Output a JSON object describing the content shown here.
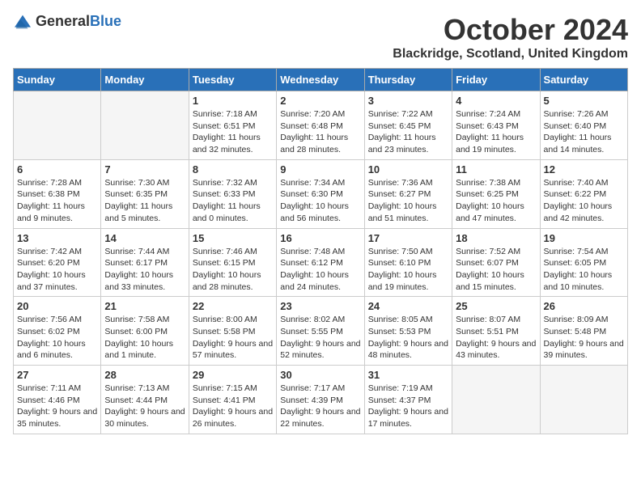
{
  "logo": {
    "general": "General",
    "blue": "Blue"
  },
  "title": "October 2024",
  "location": "Blackridge, Scotland, United Kingdom",
  "days_of_week": [
    "Sunday",
    "Monday",
    "Tuesday",
    "Wednesday",
    "Thursday",
    "Friday",
    "Saturday"
  ],
  "weeks": [
    {
      "row_style": "row-white",
      "days": [
        {
          "num": "",
          "empty": true
        },
        {
          "num": "",
          "empty": true
        },
        {
          "num": "1",
          "sunrise": "Sunrise: 7:18 AM",
          "sunset": "Sunset: 6:51 PM",
          "daylight": "Daylight: 11 hours and 32 minutes."
        },
        {
          "num": "2",
          "sunrise": "Sunrise: 7:20 AM",
          "sunset": "Sunset: 6:48 PM",
          "daylight": "Daylight: 11 hours and 28 minutes."
        },
        {
          "num": "3",
          "sunrise": "Sunrise: 7:22 AM",
          "sunset": "Sunset: 6:45 PM",
          "daylight": "Daylight: 11 hours and 23 minutes."
        },
        {
          "num": "4",
          "sunrise": "Sunrise: 7:24 AM",
          "sunset": "Sunset: 6:43 PM",
          "daylight": "Daylight: 11 hours and 19 minutes."
        },
        {
          "num": "5",
          "sunrise": "Sunrise: 7:26 AM",
          "sunset": "Sunset: 6:40 PM",
          "daylight": "Daylight: 11 hours and 14 minutes."
        }
      ]
    },
    {
      "row_style": "row-gray",
      "days": [
        {
          "num": "6",
          "sunrise": "Sunrise: 7:28 AM",
          "sunset": "Sunset: 6:38 PM",
          "daylight": "Daylight: 11 hours and 9 minutes."
        },
        {
          "num": "7",
          "sunrise": "Sunrise: 7:30 AM",
          "sunset": "Sunset: 6:35 PM",
          "daylight": "Daylight: 11 hours and 5 minutes."
        },
        {
          "num": "8",
          "sunrise": "Sunrise: 7:32 AM",
          "sunset": "Sunset: 6:33 PM",
          "daylight": "Daylight: 11 hours and 0 minutes."
        },
        {
          "num": "9",
          "sunrise": "Sunrise: 7:34 AM",
          "sunset": "Sunset: 6:30 PM",
          "daylight": "Daylight: 10 hours and 56 minutes."
        },
        {
          "num": "10",
          "sunrise": "Sunrise: 7:36 AM",
          "sunset": "Sunset: 6:27 PM",
          "daylight": "Daylight: 10 hours and 51 minutes."
        },
        {
          "num": "11",
          "sunrise": "Sunrise: 7:38 AM",
          "sunset": "Sunset: 6:25 PM",
          "daylight": "Daylight: 10 hours and 47 minutes."
        },
        {
          "num": "12",
          "sunrise": "Sunrise: 7:40 AM",
          "sunset": "Sunset: 6:22 PM",
          "daylight": "Daylight: 10 hours and 42 minutes."
        }
      ]
    },
    {
      "row_style": "row-white",
      "days": [
        {
          "num": "13",
          "sunrise": "Sunrise: 7:42 AM",
          "sunset": "Sunset: 6:20 PM",
          "daylight": "Daylight: 10 hours and 37 minutes."
        },
        {
          "num": "14",
          "sunrise": "Sunrise: 7:44 AM",
          "sunset": "Sunset: 6:17 PM",
          "daylight": "Daylight: 10 hours and 33 minutes."
        },
        {
          "num": "15",
          "sunrise": "Sunrise: 7:46 AM",
          "sunset": "Sunset: 6:15 PM",
          "daylight": "Daylight: 10 hours and 28 minutes."
        },
        {
          "num": "16",
          "sunrise": "Sunrise: 7:48 AM",
          "sunset": "Sunset: 6:12 PM",
          "daylight": "Daylight: 10 hours and 24 minutes."
        },
        {
          "num": "17",
          "sunrise": "Sunrise: 7:50 AM",
          "sunset": "Sunset: 6:10 PM",
          "daylight": "Daylight: 10 hours and 19 minutes."
        },
        {
          "num": "18",
          "sunrise": "Sunrise: 7:52 AM",
          "sunset": "Sunset: 6:07 PM",
          "daylight": "Daylight: 10 hours and 15 minutes."
        },
        {
          "num": "19",
          "sunrise": "Sunrise: 7:54 AM",
          "sunset": "Sunset: 6:05 PM",
          "daylight": "Daylight: 10 hours and 10 minutes."
        }
      ]
    },
    {
      "row_style": "row-gray",
      "days": [
        {
          "num": "20",
          "sunrise": "Sunrise: 7:56 AM",
          "sunset": "Sunset: 6:02 PM",
          "daylight": "Daylight: 10 hours and 6 minutes."
        },
        {
          "num": "21",
          "sunrise": "Sunrise: 7:58 AM",
          "sunset": "Sunset: 6:00 PM",
          "daylight": "Daylight: 10 hours and 1 minute."
        },
        {
          "num": "22",
          "sunrise": "Sunrise: 8:00 AM",
          "sunset": "Sunset: 5:58 PM",
          "daylight": "Daylight: 9 hours and 57 minutes."
        },
        {
          "num": "23",
          "sunrise": "Sunrise: 8:02 AM",
          "sunset": "Sunset: 5:55 PM",
          "daylight": "Daylight: 9 hours and 52 minutes."
        },
        {
          "num": "24",
          "sunrise": "Sunrise: 8:05 AM",
          "sunset": "Sunset: 5:53 PM",
          "daylight": "Daylight: 9 hours and 48 minutes."
        },
        {
          "num": "25",
          "sunrise": "Sunrise: 8:07 AM",
          "sunset": "Sunset: 5:51 PM",
          "daylight": "Daylight: 9 hours and 43 minutes."
        },
        {
          "num": "26",
          "sunrise": "Sunrise: 8:09 AM",
          "sunset": "Sunset: 5:48 PM",
          "daylight": "Daylight: 9 hours and 39 minutes."
        }
      ]
    },
    {
      "row_style": "row-white",
      "days": [
        {
          "num": "27",
          "sunrise": "Sunrise: 7:11 AM",
          "sunset": "Sunset: 4:46 PM",
          "daylight": "Daylight: 9 hours and 35 minutes."
        },
        {
          "num": "28",
          "sunrise": "Sunrise: 7:13 AM",
          "sunset": "Sunset: 4:44 PM",
          "daylight": "Daylight: 9 hours and 30 minutes."
        },
        {
          "num": "29",
          "sunrise": "Sunrise: 7:15 AM",
          "sunset": "Sunset: 4:41 PM",
          "daylight": "Daylight: 9 hours and 26 minutes."
        },
        {
          "num": "30",
          "sunrise": "Sunrise: 7:17 AM",
          "sunset": "Sunset: 4:39 PM",
          "daylight": "Daylight: 9 hours and 22 minutes."
        },
        {
          "num": "31",
          "sunrise": "Sunrise: 7:19 AM",
          "sunset": "Sunset: 4:37 PM",
          "daylight": "Daylight: 9 hours and 17 minutes."
        },
        {
          "num": "",
          "empty": true
        },
        {
          "num": "",
          "empty": true
        }
      ]
    }
  ]
}
